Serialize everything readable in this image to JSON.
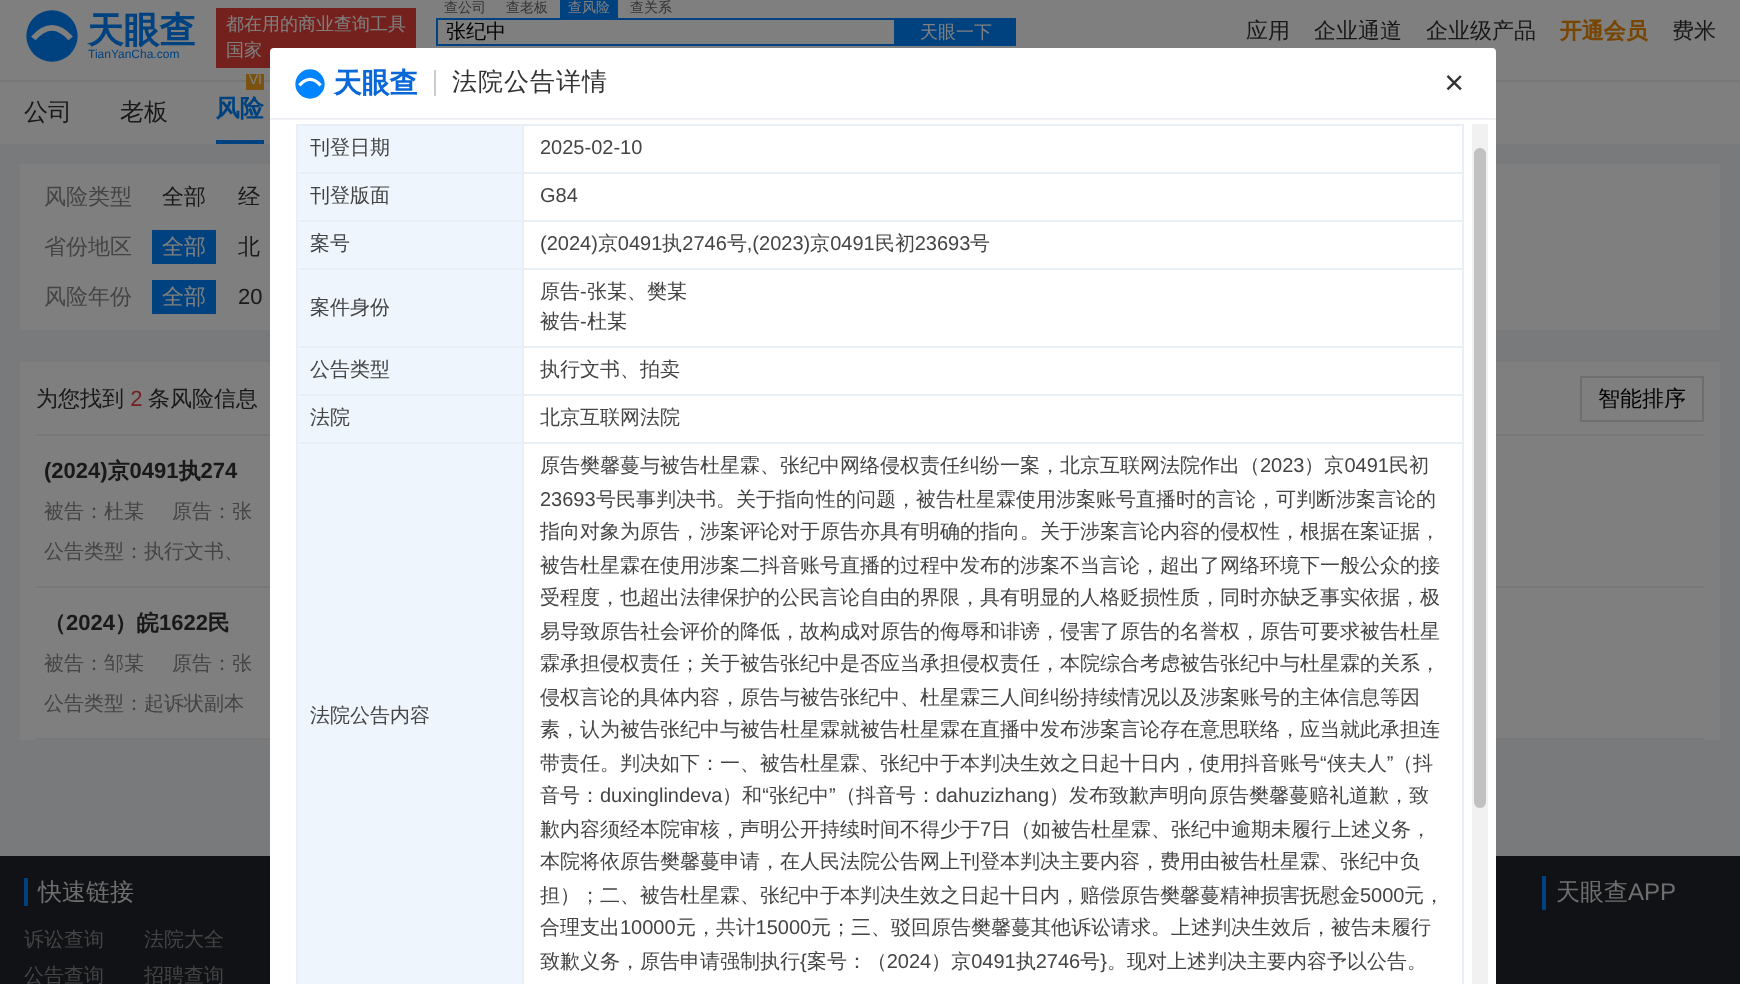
{
  "header": {
    "logo": "天眼查",
    "logo_sub": "TianYanCha.com",
    "slogan": [
      "都在用的商业查询工具",
      "国家"
    ],
    "search_tabs": [
      {
        "label": "查公司",
        "selected": false
      },
      {
        "label": "查老板",
        "selected": false
      },
      {
        "label": "查风险",
        "selected": true
      },
      {
        "label": "查关系",
        "selected": false
      }
    ],
    "search": {
      "value": "张纪中"
    },
    "search_button": "天眼一下",
    "nav": [
      "应用",
      "企业通道",
      "企业级产品"
    ],
    "vip": "开通会员",
    "user": "费米"
  },
  "tabs": [
    {
      "label": "公司",
      "selected": false
    },
    {
      "label": "老板",
      "selected": false
    },
    {
      "label": "风险",
      "selected": true,
      "badge": "VI"
    }
  ],
  "filters": [
    {
      "label": "风险类型",
      "options": [
        {
          "label": "全部",
          "selected": false
        },
        {
          "label": "经",
          "selected": false
        }
      ]
    },
    {
      "label": "省份地区",
      "options": [
        {
          "label": "全部",
          "selected": true
        },
        {
          "label": "北",
          "selected": false
        }
      ]
    },
    {
      "label": "风险年份",
      "options": [
        {
          "label": "全部",
          "selected": true
        },
        {
          "label": "20",
          "selected": false
        }
      ]
    }
  ],
  "results": {
    "summary": [
      "为您找到",
      "2",
      "条风险信息"
    ],
    "sort": "智能排序",
    "items": [
      {
        "title": "(2024)京0491执274",
        "meta": [
          "被告：杜某",
          "原告：张"
        ],
        "type": "公告类型：执行文书、"
      },
      {
        "title": "（2024）皖1622民",
        "meta": [
          "被告：邹某",
          "原告：张"
        ],
        "type": "公告类型：起诉状副本"
      }
    ]
  },
  "footer": {
    "title": "快速链接",
    "links": [
      "诉讼查询",
      "法院大全",
      "公告查询",
      "招聘查询"
    ],
    "app": "天眼查APP"
  },
  "modal": {
    "logo": "天眼查",
    "title": "法院公告详情",
    "close": "×",
    "rows": [
      {
        "label": "刊登日期",
        "lines": [
          "2025-02-10"
        ]
      },
      {
        "label": "刊登版面",
        "lines": [
          "G84"
        ]
      },
      {
        "label": "案号",
        "lines": [
          "(2024)京0491执2746号,(2023)京0491民初23693号"
        ]
      },
      {
        "label": "案件身份",
        "lines": [
          "原告-张某、樊某",
          "被告-杜某"
        ]
      },
      {
        "label": "公告类型",
        "lines": [
          "执行文书、拍卖"
        ]
      },
      {
        "label": "法院",
        "lines": [
          "北京互联网法院"
        ]
      },
      {
        "label": "法院公告内容",
        "lines": [
          "原告樊馨蔓与被告杜星霖、张纪中网络侵权责任纠纷一案，北京互联网法院作出（2023）京0491民初23693号民事判决书。关于指向性的问题，被告杜星霖使用涉案账号直播时的言论，可判断涉案言论的指向对象为原告，涉案评论对于原告亦具有明确的指向。关于涉案言论内容的侵权性，根据在案证据，被告杜星霖在使用涉案二抖音账号直播的过程中发布的涉案不当言论，超出了网络环境下一般公众的接受程度，也超出法律保护的公民言论自由的界限，具有明显的人格贬损性质，同时亦缺乏事实依据，极易导致原告社会评价的降低，故构成对原告的侮辱和诽谤，侵害了原告的名誉权，原告可要求被告杜星霖承担侵权责任；关于被告张纪中是否应当承担侵权责任，本院综合考虑被告张纪中与杜星霖的关系，侵权言论的具体内容，原告与被告张纪中、杜星霖三人间纠纷持续情况以及涉案账号的主体信息等因素，认为被告张纪中与被告杜星霖就被告杜星霖在直播中发布涉案言论存在意思联络，应当就此承担连带责任。判决如下：一、被告杜星霖、张纪中于本判决生效之日起十日内，使用抖音账号“侠夫人”（抖音号：duxinglindeva）和“张纪中”（抖音号：dahuzizhang）发布致歉声明向原告樊馨蔓赔礼道歉，致歉内容须经本院审核，声明公开持续时间不得少于7日（如被告杜星霖、张纪中逾期未履行上述义务，本院将依原告樊馨蔓申请，在人民法院公告网上刊登本判决主要内容，费用由被告杜星霖、张纪中负担）；二、被告杜星霖、张纪中于本判决生效之日起十日内，赔偿原告樊馨蔓精神损害抚慰金5000元，合理支出10000元，共计15000元；三、驳回原告樊馨蔓其他诉讼请求。上述判决生效后，被告未履行致歉义务，原告申请强制执行{案号：（2024）京0491执2746号}。现对上述判决主要内容予以公告。"
        ]
      }
    ]
  }
}
